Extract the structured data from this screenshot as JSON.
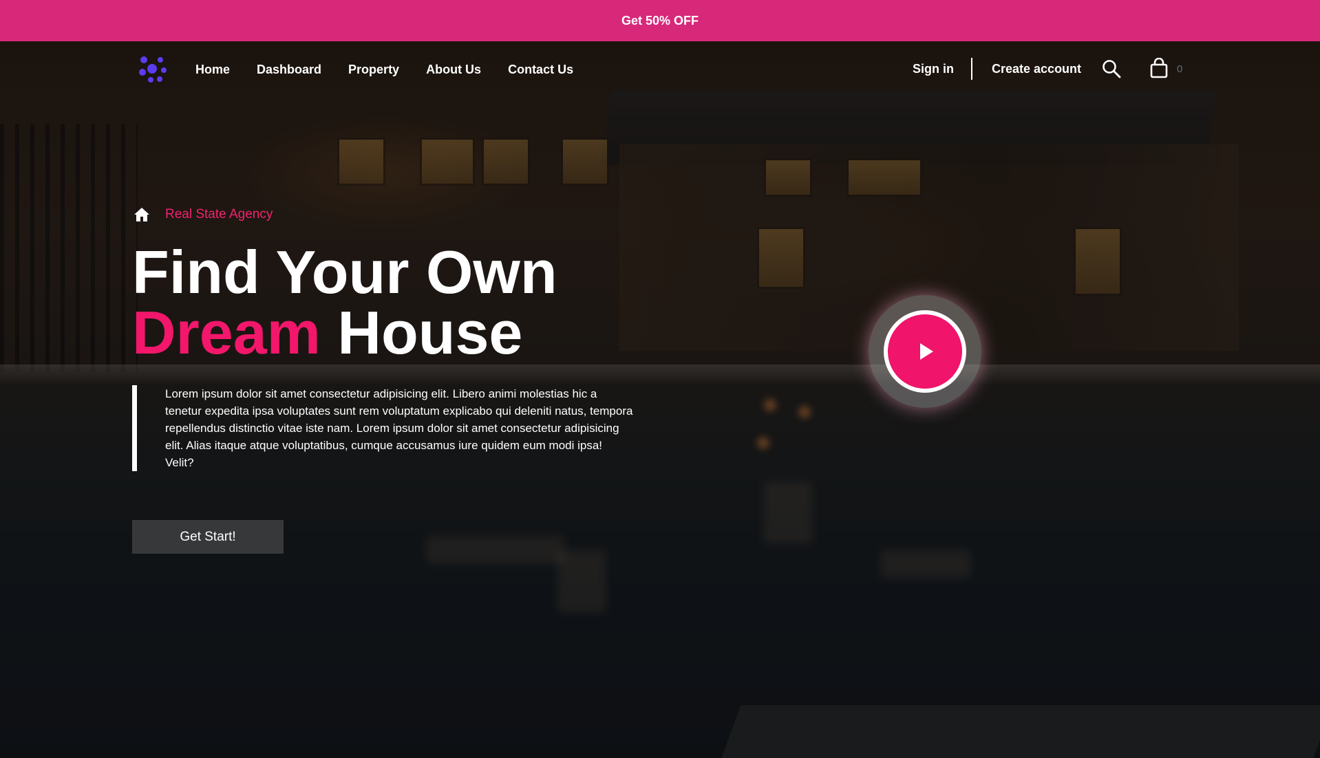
{
  "promo": {
    "text": "Get 50% OFF"
  },
  "nav": {
    "logo_icon": "dots-cluster-logo",
    "links": [
      "Home",
      "Dashboard",
      "Property",
      "About Us",
      "Contact Us"
    ],
    "sign_in": "Sign in",
    "create_account": "Create account",
    "search_icon": "search-icon",
    "bag_icon": "shopping-bag-icon",
    "cart_count": "0"
  },
  "hero": {
    "tagline": "Real State Agency",
    "headline_line1": "Find Your Own",
    "headline_accent": "Dream",
    "headline_rest": "House",
    "description": "Lorem ipsum dolor sit amet consectetur adipisicing elit. Libero animi molestias hic a tenetur expedita ipsa voluptates sunt rem voluptatum explicabo qui deleniti natus, tempora repellendus distinctio vitae iste nam. Lorem ipsum dolor sit amet consectetur adipisicing elit. Alias itaque atque voluptatibus, cumque accusamus iure quidem eum modi ipsa! Velit?",
    "cta_label": "Get Start!"
  },
  "colors": {
    "promo_bg": "#d8287a",
    "accent": "#f2176a",
    "logo": "#5b3df0"
  }
}
